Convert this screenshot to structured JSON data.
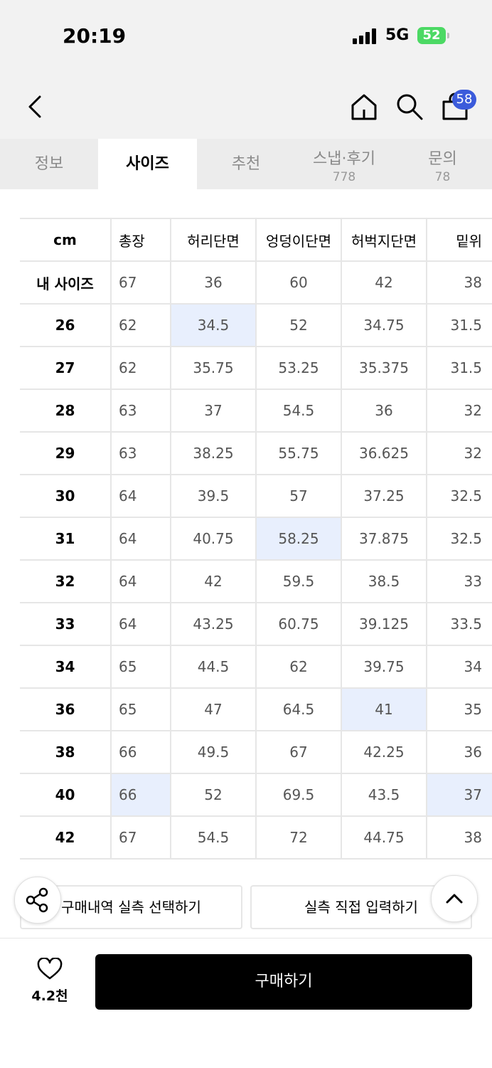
{
  "status_bar": {
    "time": "20:19",
    "network": "5G",
    "battery": "52"
  },
  "header": {
    "cart_count": "58"
  },
  "tabs": [
    {
      "label": "정보",
      "count": ""
    },
    {
      "label": "사이즈",
      "count": ""
    },
    {
      "label": "추천",
      "count": ""
    },
    {
      "label": "스냅·후기",
      "count": "778"
    },
    {
      "label": "문의",
      "count": "78"
    }
  ],
  "size_table": {
    "headers": [
      "cm",
      "총장",
      "허리단면",
      "엉덩이단면",
      "허벅지단면",
      "밑위"
    ],
    "rows": [
      [
        "내 사이즈",
        "67",
        "36",
        "60",
        "42",
        "38"
      ],
      [
        "26",
        "62",
        "34.5",
        "52",
        "34.75",
        "31.5"
      ],
      [
        "27",
        "62",
        "35.75",
        "53.25",
        "35.375",
        "31.5"
      ],
      [
        "28",
        "63",
        "37",
        "54.5",
        "36",
        "32"
      ],
      [
        "29",
        "63",
        "38.25",
        "55.75",
        "36.625",
        "32"
      ],
      [
        "30",
        "64",
        "39.5",
        "57",
        "37.25",
        "32.5"
      ],
      [
        "31",
        "64",
        "40.75",
        "58.25",
        "37.875",
        "32.5"
      ],
      [
        "32",
        "64",
        "42",
        "59.5",
        "38.5",
        "33"
      ],
      [
        "33",
        "64",
        "43.25",
        "60.75",
        "39.125",
        "33.5"
      ],
      [
        "34",
        "65",
        "44.5",
        "62",
        "39.75",
        "34"
      ],
      [
        "36",
        "65",
        "47",
        "64.5",
        "41",
        "35"
      ],
      [
        "38",
        "66",
        "49.5",
        "67",
        "42.25",
        "36"
      ],
      [
        "40",
        "66",
        "52",
        "69.5",
        "43.5",
        "37"
      ],
      [
        "42",
        "67",
        "54.5",
        "72",
        "44.75",
        "38"
      ]
    ],
    "highlight_color": "#e8effd"
  },
  "actions": {
    "purchase_history_label": "구매내역 실측 선택하기",
    "direct_input_label": "실측 직접 입력하기"
  },
  "bottom": {
    "like_count": "4.2천",
    "buy_label": "구매하기"
  },
  "colors": {
    "accent_badge": "#3b5bdb",
    "battery": "#4cd964",
    "buy_button": "#000000"
  }
}
